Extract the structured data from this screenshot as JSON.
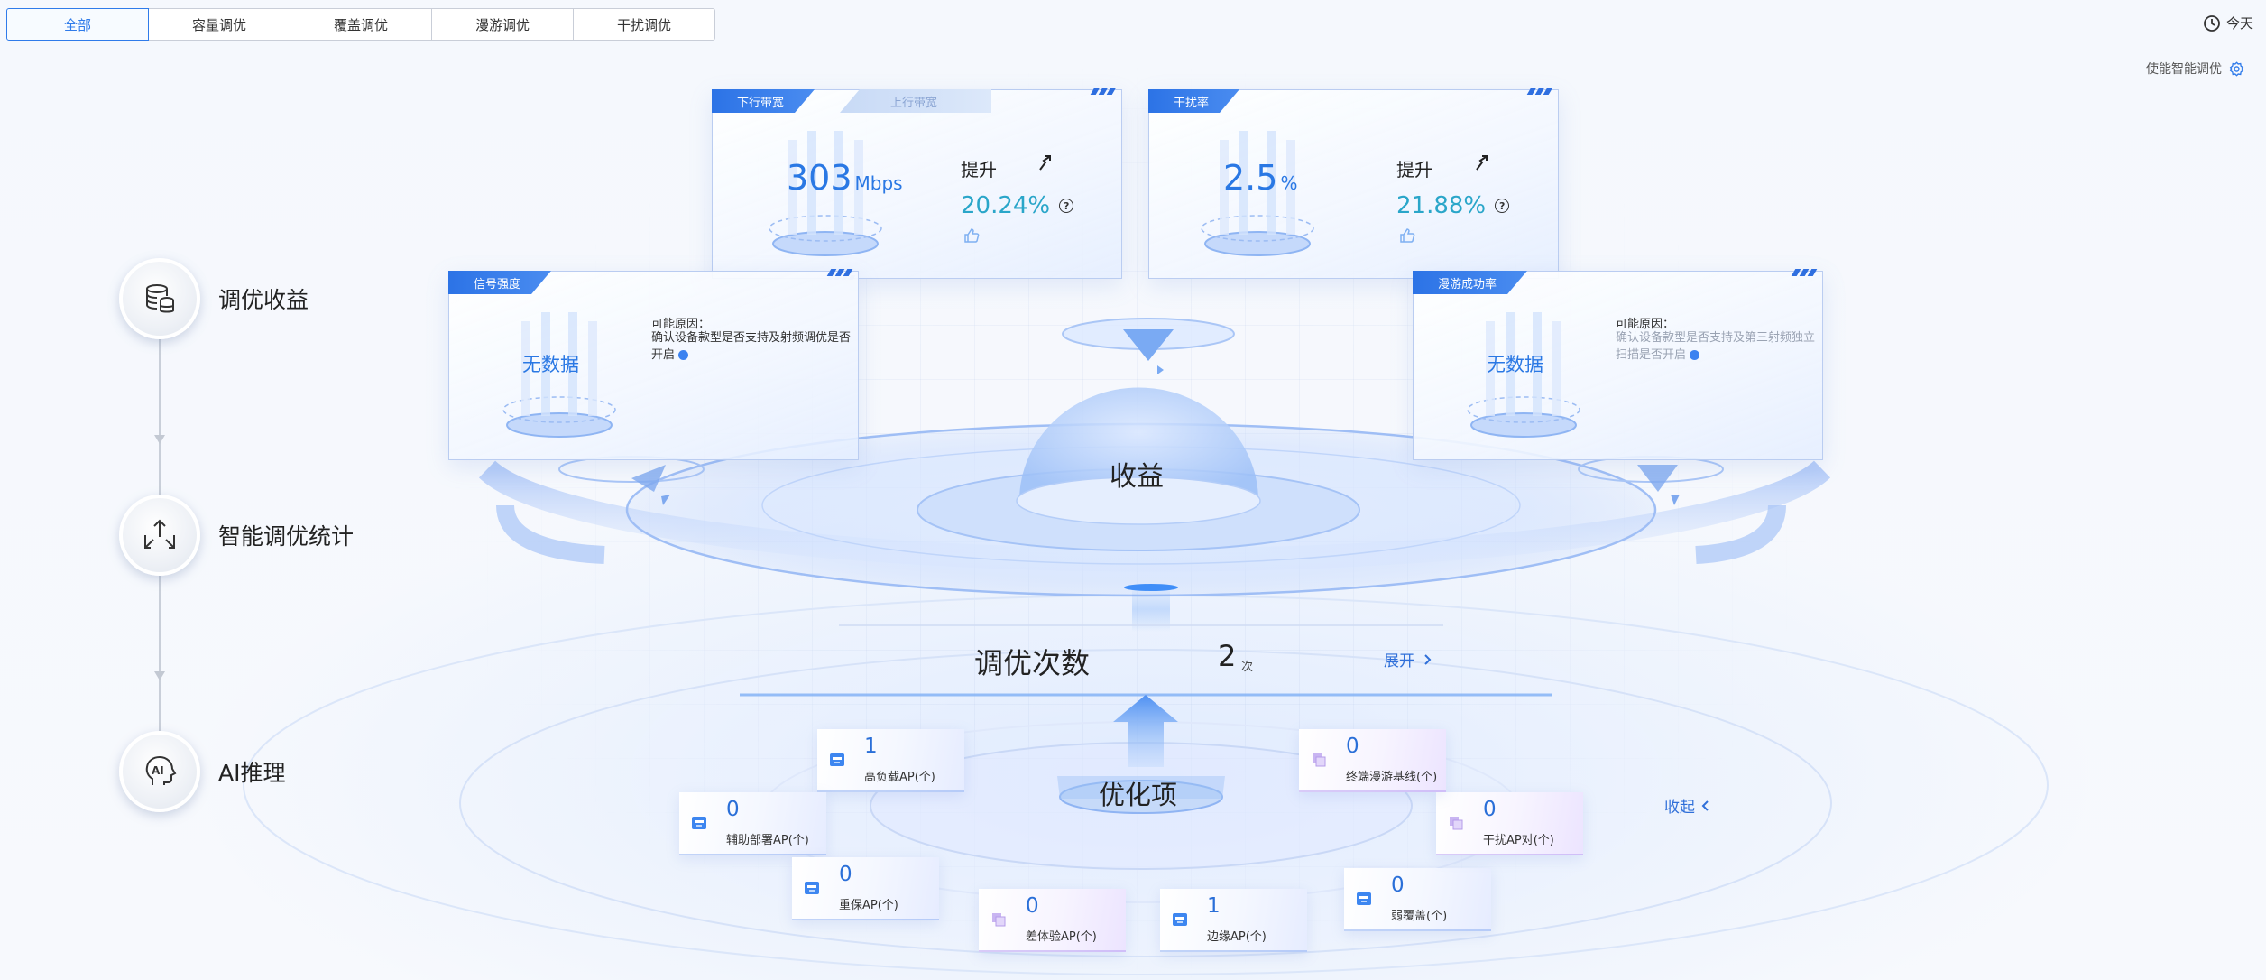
{
  "tabs": [
    "全部",
    "容量调优",
    "覆盖调优",
    "漫游调优",
    "干扰调优"
  ],
  "active_tab": 0,
  "top_right": {
    "today_label": "今天",
    "enable_label": "使能智能调优"
  },
  "steps": [
    {
      "label": "调优收益",
      "icon": "database-icon"
    },
    {
      "label": "智能调优统计",
      "icon": "expand-arrows-icon"
    },
    {
      "label": "AI推理",
      "icon": "ai-head-icon"
    }
  ],
  "cards": {
    "bandwidth": {
      "tab_active": "下行带宽",
      "tab_inactive": "上行带宽",
      "value": "303",
      "unit": "Mbps",
      "improve_label": "提升",
      "improve_pct": "20.24%"
    },
    "interference": {
      "tab_active": "干扰率",
      "value": "2.5",
      "unit": "%",
      "improve_label": "提升",
      "improve_pct": "21.88%"
    },
    "signal": {
      "tab_active": "信号强度",
      "no_data": "无数据",
      "reason_title": "可能原因：",
      "reason_line1": "确认设备款型是否支持及射频调优是否",
      "reason_line2": "开启"
    },
    "roaming": {
      "tab_active": "漫游成功率",
      "no_data": "无数据",
      "reason_title": "可能原因：",
      "reason_line1": "确认设备款型是否支持及第三射频独立",
      "reason_line2": "扫描是否开启"
    }
  },
  "center": {
    "benefit_label": "收益",
    "count_label": "调优次数",
    "count_value": "2",
    "count_unit": "次",
    "expand_label": "展开",
    "optimize_label": "优化项",
    "collapse_label": "收起"
  },
  "items": [
    {
      "key": "high_load",
      "value": "1",
      "label": "高负载AP(个)",
      "theme": "blue"
    },
    {
      "key": "auxiliary",
      "value": "0",
      "label": "辅助部署AP(个)",
      "theme": "blue"
    },
    {
      "key": "guarantee",
      "value": "0",
      "label": "重保AP(个)",
      "theme": "blue"
    },
    {
      "key": "experience",
      "value": "0",
      "label": "差体验AP(个)",
      "theme": "purple"
    },
    {
      "key": "edge",
      "value": "1",
      "label": "边缘AP(个)",
      "theme": "blue"
    },
    {
      "key": "weak_coverage",
      "value": "0",
      "label": "弱覆盖(个)",
      "theme": "blue"
    },
    {
      "key": "interference_pair",
      "value": "0",
      "label": "干扰AP对(个)",
      "theme": "purple"
    },
    {
      "key": "roaming_baseline",
      "value": "0",
      "label": "终端漫游基线(个)",
      "theme": "purple"
    }
  ],
  "colors": {
    "accent": "#2f7bea",
    "value_blue": "#2a78e4",
    "pct_cyan": "#2aa6c9"
  }
}
